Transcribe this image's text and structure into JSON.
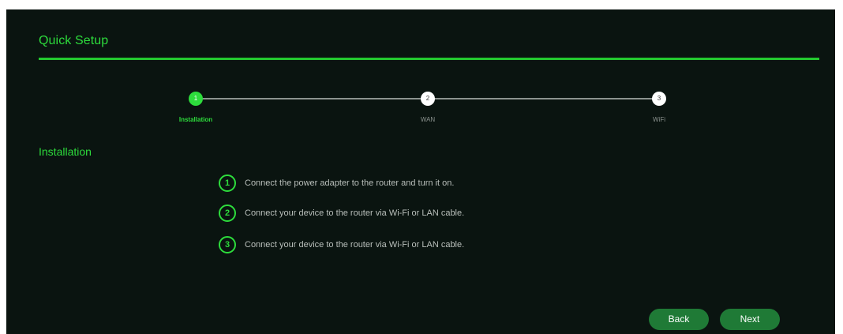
{
  "header": {
    "title": "Quick Setup"
  },
  "stepper": {
    "steps": [
      {
        "number": "1",
        "label": "Installation",
        "active": true
      },
      {
        "number": "2",
        "label": "WAN",
        "active": false
      },
      {
        "number": "3",
        "label": "WiFi",
        "active": false
      }
    ]
  },
  "section": {
    "title": "Installation"
  },
  "instructions": [
    {
      "number": "1",
      "text": "Connect the power adapter to the router and turn it on."
    },
    {
      "number": "2",
      "text": "Connect your device to the router via Wi-Fi or LAN cable."
    },
    {
      "number": "3",
      "text": "Connect your device to the router via Wi-Fi or LAN cable."
    }
  ],
  "buttons": {
    "back": "Back",
    "next": "Next"
  },
  "colors": {
    "accent": "#2ddc3c",
    "background": "#0a1410",
    "button": "#1f7a36"
  }
}
